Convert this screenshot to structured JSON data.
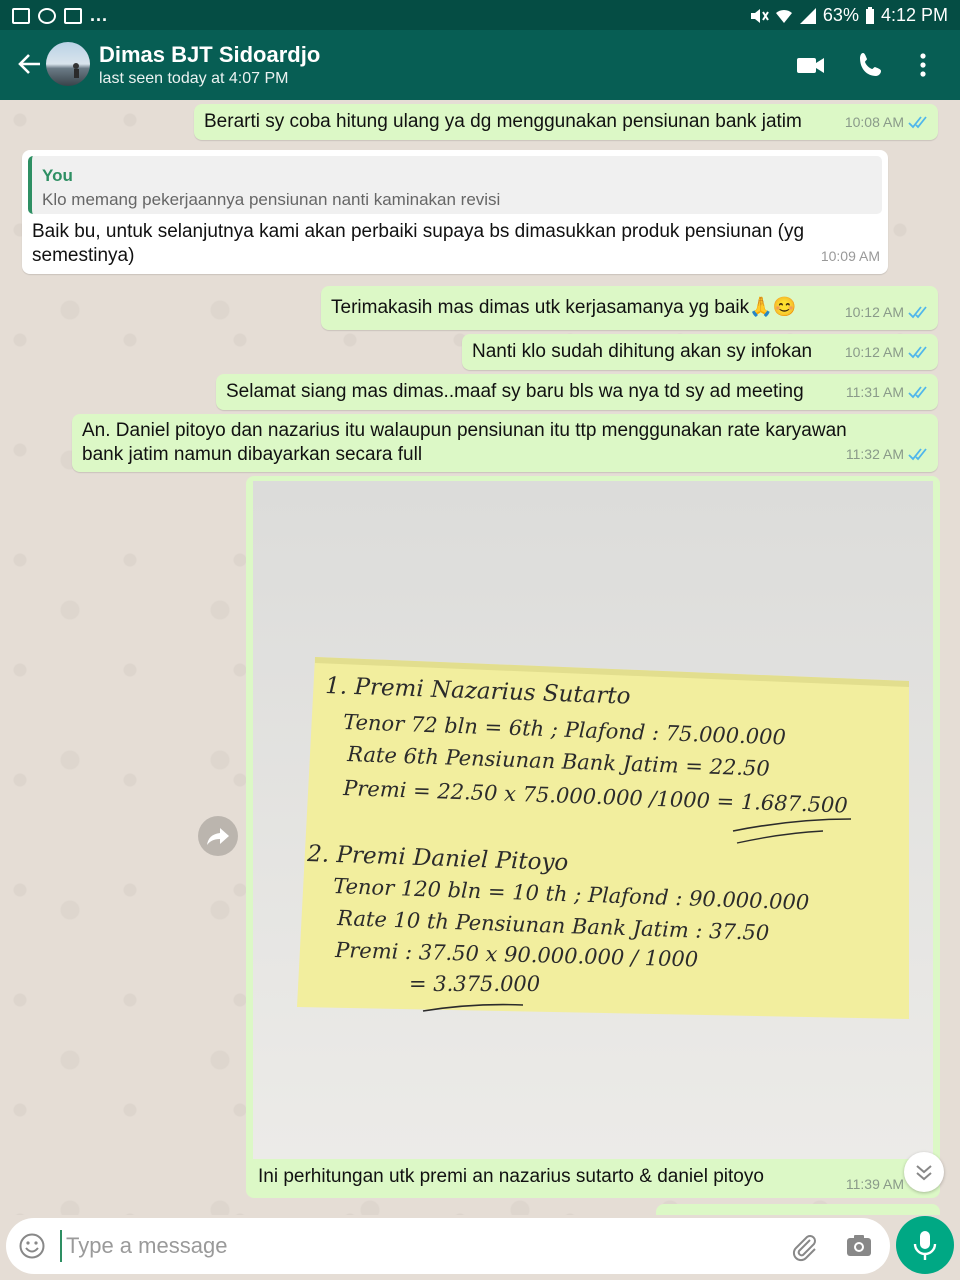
{
  "status_bar": {
    "battery": "63%",
    "time": "4:12 PM",
    "notif_more": "..."
  },
  "header": {
    "contact_name": "Dimas BJT Sidoardjo",
    "last_seen": "last seen today at 4:07 PM"
  },
  "messages": [
    {
      "dir": "out",
      "text": "Berarti sy coba hitung ulang ya dg menggunakan pensiunan bank jatim",
      "time": "10:08 AM"
    },
    {
      "dir": "in",
      "quote_name": "You",
      "quote_text": "Klo memang pekerjaannya pensiunan nanti kaminakan revisi",
      "text_line1": "Baik bu, untuk selanjutnya kami akan perbaiki supaya bs dimasukkan produk pensiunan (yg",
      "text_line2": "semestinya)",
      "time": "10:09 AM"
    },
    {
      "dir": "out",
      "text": "Terimakasih mas dimas utk kerjasamanya yg baik🙏😊",
      "time": "10:12 AM"
    },
    {
      "dir": "out",
      "text": "Nanti klo sudah dihitung akan sy infokan",
      "time": "10:12 AM"
    },
    {
      "dir": "out",
      "text": "Selamat siang mas dimas..maaf sy baru bls wa nya td sy ad meeting",
      "time": "11:31 AM"
    },
    {
      "dir": "out",
      "text_line1": "An. Daniel pitoyo dan nazarius itu walaupun pensiunan itu ttp menggunakan rate karyawan",
      "text_line2": "bank jatim namun dibayarkan secara full",
      "time": "11:32 AM"
    },
    {
      "dir": "out",
      "caption": "Ini perhitungan utk premi an nazarius sutarto & daniel pitoyo",
      "time": "11:39 AM"
    }
  ],
  "note": {
    "l1": "1. Premi Nazarius Sutarto",
    "l2": "Tenor  72 bln = 6th   ;  Plafond : 75.000.000",
    "l3": "Rate  6th  Pensiunan  Bank Jatim = 22.50",
    "l4": "Premi =  22.50  x 75.000.000 /1000 = 1.687.500",
    "l5": "2. Premi Daniel Pitoyo",
    "l6": "Tenor  120 bln = 10 th   ;  Plafond : 90.000.000",
    "l7": "Rate  10 th  Pensiunan  Bank Jatim : 37.50",
    "l8": "Premi :  37.50 x 90.000.000 / 1000",
    "l9": "= 3.375.000"
  },
  "input": {
    "placeholder": "Type a message"
  }
}
